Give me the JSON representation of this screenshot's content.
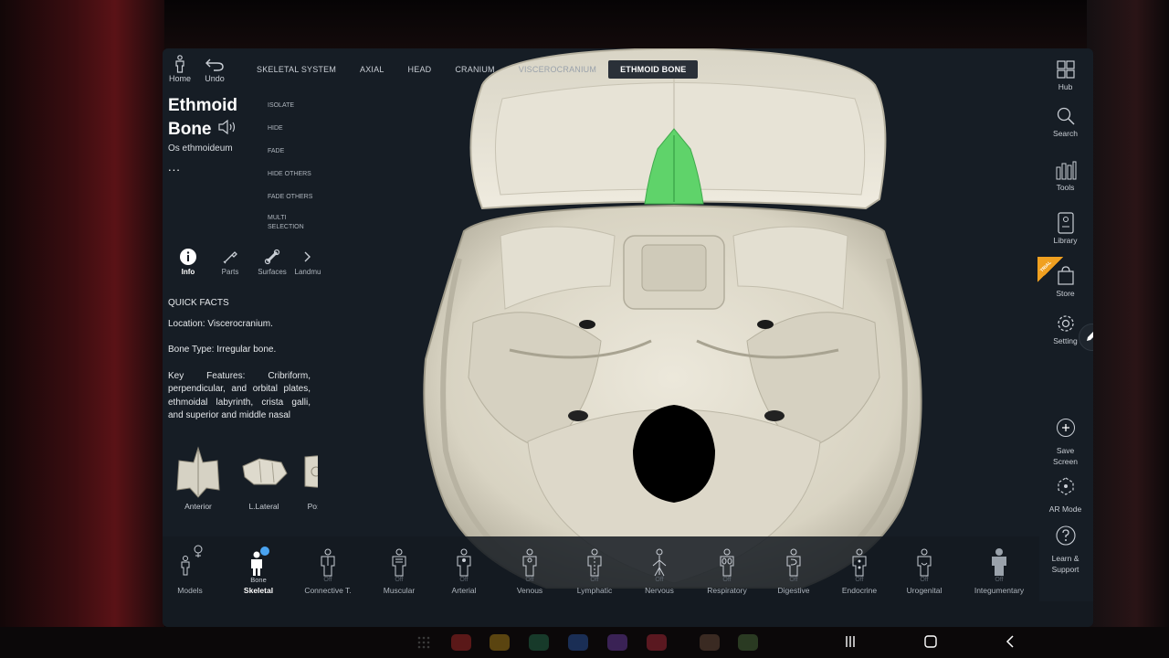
{
  "app": {
    "home_label": "Home",
    "undo_label": "Undo",
    "breadcrumbs": [
      "SKELETAL SYSTEM",
      "AXIAL",
      "HEAD",
      "CRANIUM",
      "VISCEROCRANIUM",
      "ETHMOID BONE"
    ]
  },
  "structure": {
    "title_line1": "Ethmoid",
    "title_line2": "Bone",
    "latin_name": "Os ethmoideum",
    "more": "...",
    "actions": [
      "ISOLATE",
      "HIDE",
      "FADE",
      "HIDE OTHERS",
      "FADE OTHERS",
      "MULTI SELECTION"
    ]
  },
  "tabs": [
    {
      "label": "Info",
      "icon": "info-icon"
    },
    {
      "label": "Parts",
      "icon": "parts-icon"
    },
    {
      "label": "Surfaces",
      "icon": "surfaces-icon"
    },
    {
      "label": "Landmu",
      "icon": "landmarks-icon"
    }
  ],
  "quick_facts": {
    "heading": "QUICK FACTS",
    "location": "Location: Viscerocranium.",
    "bone_type": "Bone Type: Irregular bone.",
    "key_features": "Key Features: Cribriform, perpendicular, and orbital plates, ethmoidal labyrinth, crista galli, and superior and middle nasal"
  },
  "views": [
    {
      "label": "Anterior"
    },
    {
      "label": "L.Lateral"
    },
    {
      "label": "Po:"
    }
  ],
  "right_toolbar": [
    {
      "label": "Hub",
      "icon": "hub-icon"
    },
    {
      "label": "Search",
      "icon": "search-icon"
    },
    {
      "label": "Tools",
      "icon": "tools-icon"
    },
    {
      "label": "Library",
      "icon": "library-icon"
    },
    {
      "label": "Store",
      "icon": "store-icon"
    },
    {
      "label": "Setting",
      "icon": "gear-icon"
    },
    {
      "label": "Save Screen",
      "icon": "plus-icon"
    },
    {
      "label": "AR Mode",
      "icon": "ar-icon"
    },
    {
      "label": "Learn & Support",
      "icon": "help-icon"
    }
  ],
  "trial_badge": "TRIAL",
  "systems": [
    {
      "label": "Models",
      "state": ""
    },
    {
      "label": "Skeletal",
      "state": "Bone"
    },
    {
      "label": "Connective T.",
      "state": "Off"
    },
    {
      "label": "Muscular",
      "state": "Off"
    },
    {
      "label": "Arterial",
      "state": "Off"
    },
    {
      "label": "Venous",
      "state": "Off"
    },
    {
      "label": "Lymphatic",
      "state": "Off"
    },
    {
      "label": "Nervous",
      "state": "Off"
    },
    {
      "label": "Respiratory",
      "state": "Off"
    },
    {
      "label": "Digestive",
      "state": "Off"
    },
    {
      "label": "Endocrine",
      "state": "Off"
    },
    {
      "label": "Urogenital",
      "state": "Off"
    },
    {
      "label": "Integumentary",
      "state": "Off"
    }
  ],
  "colors": {
    "highlight": "#5fd36a",
    "bone": "#e4e0d2",
    "panel": "#141a21",
    "trial": "#f0a020"
  }
}
